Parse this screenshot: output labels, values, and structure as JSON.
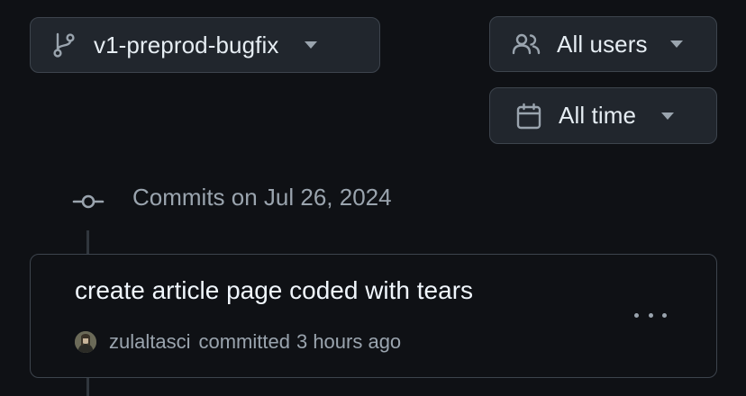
{
  "filters": {
    "branch": {
      "label": "v1-preprod-bugfix",
      "icon": "git-branch-icon"
    },
    "users": {
      "label": "All users",
      "icon": "people-icon"
    },
    "time": {
      "label": "All time",
      "icon": "calendar-icon"
    }
  },
  "commits_group": {
    "heading": "Commits on Jul 26, 2024",
    "commits": [
      {
        "title": "create article page coded with tears",
        "author": "zulaltasci",
        "action": "committed",
        "time_ago": "3 hours ago"
      }
    ]
  }
}
